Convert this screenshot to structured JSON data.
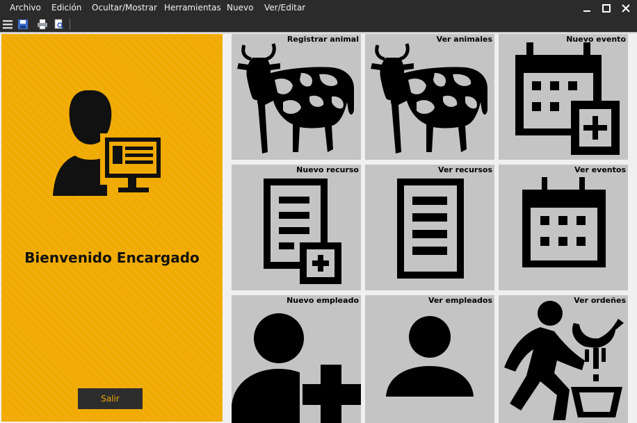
{
  "menu": {
    "items": [
      "Archivo",
      "Edición",
      "Ocultar/Mostrar",
      "Herramientas",
      "Nuevo",
      "Ver/Editar"
    ]
  },
  "window_controls": [
    "minimize-icon",
    "maximize-icon",
    "close-icon"
  ],
  "toolbar": {
    "icons": [
      "hamburger-menu-icon",
      "save-icon",
      "print-icon",
      "print-preview-icon"
    ]
  },
  "left_panel": {
    "welcome_text": "Bienvenido Encargado",
    "exit_button_label": "Salir",
    "background_color": "#f0aa00",
    "icon": "user-computer-icon"
  },
  "tiles": [
    {
      "label": "Registrar animal",
      "icon": "cow-icon"
    },
    {
      "label": "Ver animales",
      "icon": "cow-icon"
    },
    {
      "label": "Nuevo evento",
      "icon": "calendar-add-icon"
    },
    {
      "label": "Nuevo recurso",
      "icon": "document-add-icon"
    },
    {
      "label": "Ver recursos",
      "icon": "document-list-icon"
    },
    {
      "label": "Ver eventos",
      "icon": "calendar-icon"
    },
    {
      "label": "Nuevo empleado",
      "icon": "user-add-icon"
    },
    {
      "label": "Ver empleados",
      "icon": "user-icon"
    },
    {
      "label": "Ver ordeñes",
      "icon": "milking-icon"
    }
  ],
  "colors": {
    "accent": "#f0aa00",
    "tile_background": "#c4c4c4",
    "title_bar": "#2b2b2b"
  }
}
